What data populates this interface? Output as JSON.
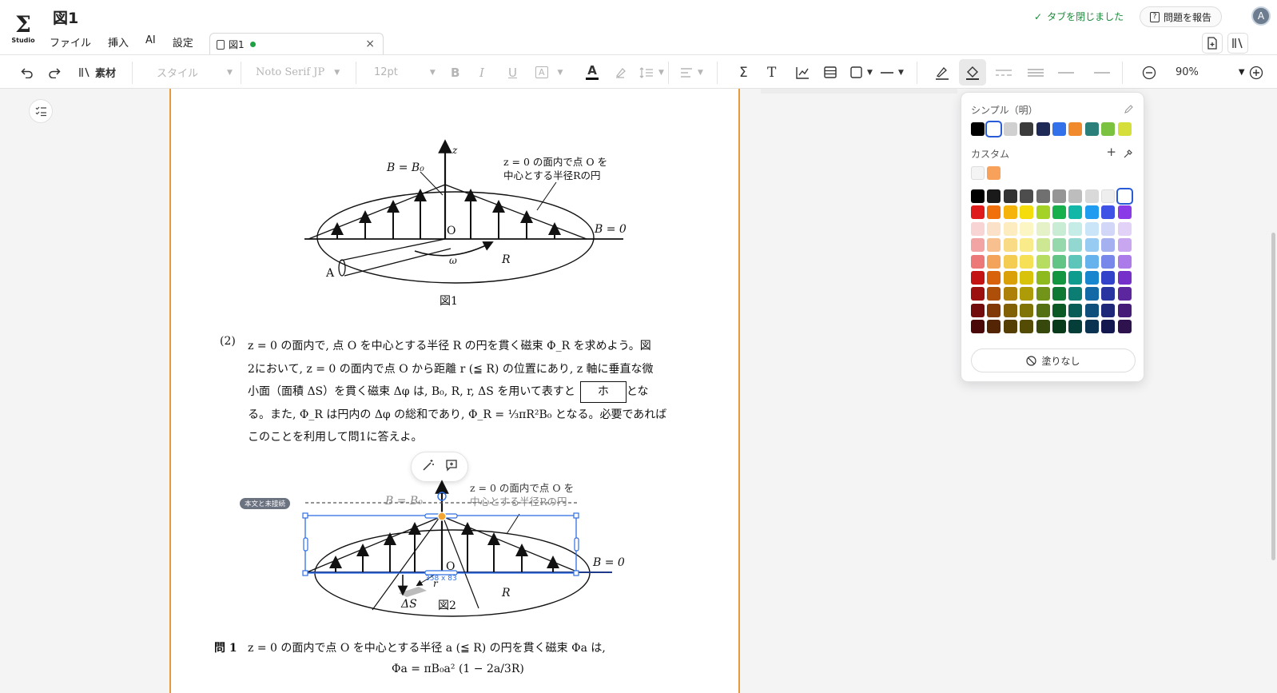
{
  "app": {
    "logo_symbol": "Σ",
    "logo_text": "Studio",
    "doc_title": "図1"
  },
  "menu": [
    "ファイル",
    "挿入",
    "AI",
    "設定"
  ],
  "tab": {
    "label": "図1",
    "close": "×"
  },
  "status": {
    "toast": "タブを閉じました",
    "report": "問題を報告",
    "avatar": "A"
  },
  "toolbar": {
    "assets": "素材",
    "style": "スタイル",
    "font": "Noto Serif JP",
    "size": "12pt",
    "bold": "B",
    "italic": "I",
    "underline": "U",
    "text_box": "A",
    "font_color": "A",
    "sigma": "Σ",
    "text_tool": "T",
    "zoom": "90%"
  },
  "figure1": {
    "b_label": "B = B₀",
    "z": "z",
    "annotation": [
      "z = 0 の面内で点 O を",
      "中心とする半径Rの円"
    ],
    "b0": "B = 0",
    "o": "O",
    "omega": "ω",
    "r": "R",
    "a": "A",
    "caption": "図1"
  },
  "question2": {
    "num": "(2)",
    "lines": [
      "z = 0 の面内で, 点 O を中心とする半径 R の円を貫く磁束 Φ_R を求めよう。図",
      "2において, z = 0 の面内で点 O から距離 r (≦ R) の位置にあり, z 軸に垂直な微",
      "小面（面積 ΔS）を貫く磁束 Δφ は, B₀, R, r, ΔS を用いて表すと",
      "る。また, Φ_R は円内の Δφ の総和であり, Φ_R = ⅓πR²B₀ となる。必要であれば",
      "このことを利用して問1に答えよ。"
    ],
    "box": "ホ",
    "box_tail": "とな"
  },
  "figure2": {
    "badge": "本文と未接続",
    "size_readout": "358 x 83",
    "b_label": "B = B₀",
    "annotation": [
      "z = 0 の面内で点 O を",
      "中心とする半径Rの円"
    ],
    "b0": "B = 0",
    "o": "O",
    "r_small": "r",
    "r": "R",
    "ds": "ΔS",
    "caption": "図2"
  },
  "q1": {
    "label": "問 1",
    "text": "z = 0 の面内で点 O を中心とする半径 a (≦ R) の円を貫く磁束 Φa は,",
    "formula": "Φa = πB₀a² (1 − 2a/3R)"
  },
  "color_popover": {
    "simple_label": "シンプル（明）",
    "custom_label": "カスタム",
    "none_label": "塗りなし",
    "simple_colors": [
      "#000000",
      "#ffffff",
      "#d0d0d0",
      "#3b3b3b",
      "#1e2a55",
      "#3271ea",
      "#f08a2c",
      "#2a7f7a",
      "#7cc241",
      "#d6de3b"
    ],
    "custom_colors": [
      "#f4f4f4",
      "#f7a15a"
    ],
    "grid": [
      [
        "#000000",
        "#1a1a1a",
        "#333333",
        "#4d4d4d",
        "#707070",
        "#959595",
        "#bdbdbd",
        "#d9d9d9",
        "#eeeeee",
        "#ffffff"
      ],
      [
        "#e01b1b",
        "#f0700c",
        "#f6b40a",
        "#f5dc0b",
        "#a4d226",
        "#18b04d",
        "#12b7a8",
        "#1f9bf0",
        "#3e53e6",
        "#8a3ae6"
      ],
      [
        "#f8d4d4",
        "#fbe1c8",
        "#fcecc0",
        "#fcf5c4",
        "#e5f2c8",
        "#c9ecd4",
        "#c6ece8",
        "#cbe5f8",
        "#d2d7f8",
        "#e3d2f8"
      ],
      [
        "#f2a4a4",
        "#f7c08e",
        "#f9db86",
        "#f9ea8a",
        "#cde792",
        "#95d8ab",
        "#92d8d0",
        "#98cbf2",
        "#a5b0f0",
        "#c8a6f0"
      ],
      [
        "#ec7878",
        "#f4a35a",
        "#f5cc52",
        "#f5e056",
        "#b6dd60",
        "#62c585",
        "#5ec5bb",
        "#66b2ec",
        "#7888ea",
        "#ab7bea"
      ],
      [
        "#c41313",
        "#d8620b",
        "#d9a009",
        "#d8c20a",
        "#8eb91f",
        "#13963f",
        "#0e9c8f",
        "#1885cf",
        "#3242c9",
        "#7430c8"
      ],
      [
        "#9c1010",
        "#ad4e09",
        "#ad8007",
        "#ad9b08",
        "#729419",
        "#0f7833",
        "#0b7d72",
        "#1369a5",
        "#2834a0",
        "#5c269f"
      ],
      [
        "#730c0c",
        "#813a07",
        "#816005",
        "#817406",
        "#556f13",
        "#0b5a26",
        "#085e56",
        "#0e4f7c",
        "#1e2778",
        "#451c77"
      ],
      [
        "#4a0808",
        "#542504",
        "#543e03",
        "#544b04",
        "#37480c",
        "#073a19",
        "#053d38",
        "#093350",
        "#13194e",
        "#2d124e"
      ]
    ]
  }
}
